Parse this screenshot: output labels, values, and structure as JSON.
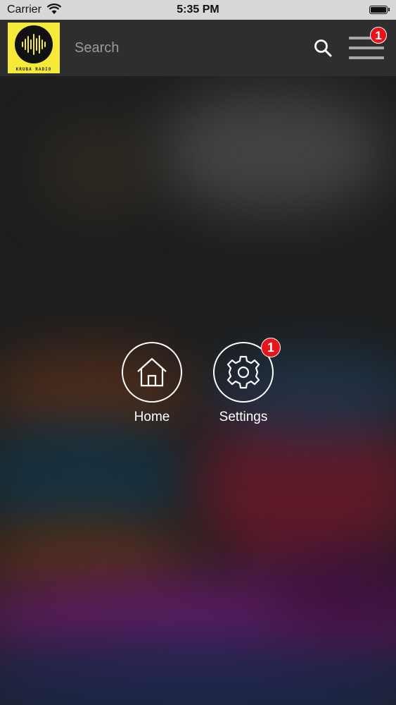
{
  "status_bar": {
    "carrier": "Carrier",
    "time": "5:35 PM",
    "wifi_icon": "wifi-icon",
    "battery_icon": "battery-icon"
  },
  "header": {
    "logo_text": "KRUBA RADIO",
    "search": {
      "placeholder": "Search",
      "value": ""
    },
    "search_icon": "search-icon",
    "menu": {
      "icon": "hamburger-menu-icon",
      "badge": "1"
    }
  },
  "nav": {
    "home": {
      "label": "Home",
      "icon": "home-icon"
    },
    "settings": {
      "label": "Settings",
      "icon": "gear-icon",
      "badge": "1"
    }
  },
  "colors": {
    "logo_background": "#f7e93a",
    "badge": "#e8141c",
    "header_background": "#2e2e2e"
  }
}
